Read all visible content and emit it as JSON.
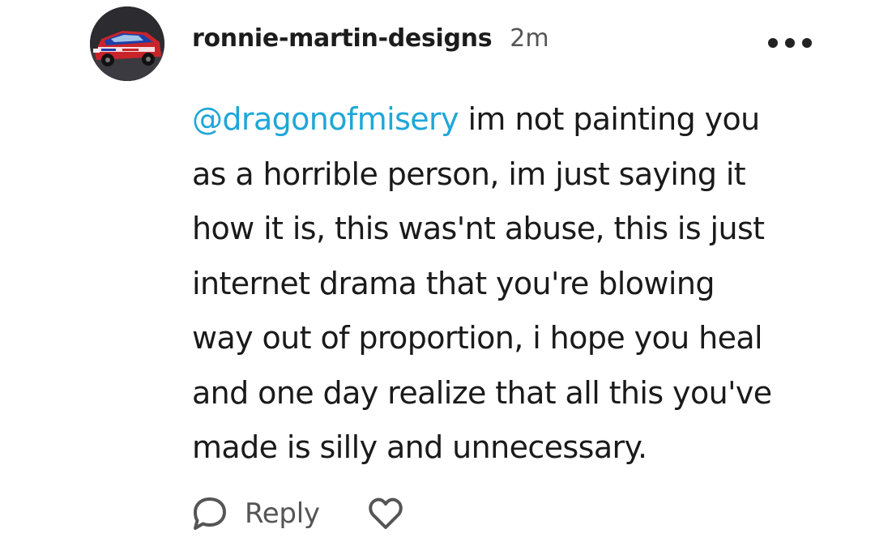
{
  "comment": {
    "author": "ronnie-martin-designs",
    "timestamp": "2m",
    "mention": "@dragonofmisery",
    "lines": [
      " im not painting you",
      "as a horrible person, im just saying it",
      "how it is, this was'nt abuse, this is just",
      "internet drama that you're blowing",
      "way out of proportion, i hope you heal",
      "and one day realize that all this you've",
      "made is silly and unnecessary."
    ],
    "mention_color": "#1ea7d8"
  },
  "actions": {
    "reply_label": "Reply",
    "reply_icon": "speech-bubble-icon",
    "like_icon": "heart-icon",
    "more_icon": "more-dots-icon"
  },
  "avatar": {
    "icon": "race-car-avatar"
  }
}
